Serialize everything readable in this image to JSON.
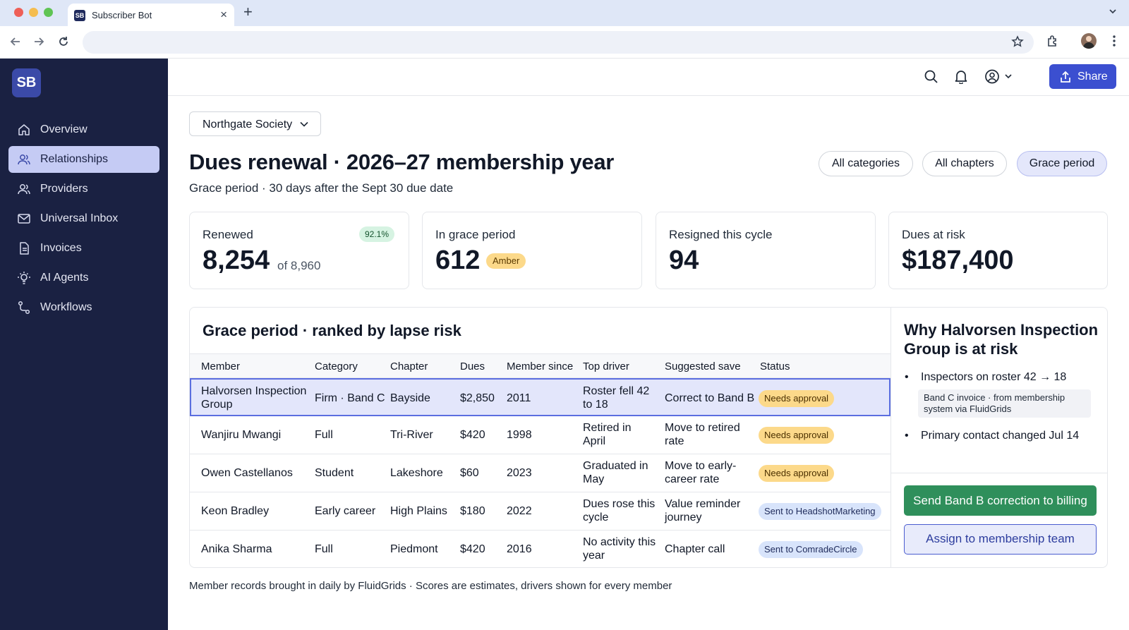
{
  "browser": {
    "tab_icon": "SB",
    "tab_title": "Subscriber Bot"
  },
  "app": {
    "logo": "SB"
  },
  "sidebar": {
    "items": [
      {
        "label": "Overview",
        "icon": "home-icon"
      },
      {
        "label": "Relationships",
        "icon": "users-icon",
        "active": true
      },
      {
        "label": "Providers",
        "icon": "users-icon"
      },
      {
        "label": "Universal Inbox",
        "icon": "mail-icon"
      },
      {
        "label": "Invoices",
        "icon": "document-icon"
      },
      {
        "label": "AI Agents",
        "icon": "bulb-icon"
      },
      {
        "label": "Workflows",
        "icon": "workflow-icon"
      }
    ]
  },
  "header": {
    "share_label": "Share"
  },
  "main": {
    "org": "Northgate Society",
    "title": "Dues renewal · 2026–27 membership year",
    "subtitle": "Grace period · 30 days after the Sept 30 due date",
    "filters": [
      "All categories",
      "All chapters",
      "Grace period"
    ],
    "active_filter": "Grace period"
  },
  "stats": [
    {
      "label": "Renewed",
      "value": "8,254",
      "of": "of 8,960",
      "badge": "92.1%"
    },
    {
      "label": "In grace period",
      "value": "612",
      "badge": "Amber"
    },
    {
      "label": "Resigned this cycle",
      "value": "94"
    },
    {
      "label": "Dues at risk",
      "value": "$187,400"
    }
  ],
  "table": {
    "title": "Grace period · ranked by lapse risk",
    "columns": [
      "Member",
      "Category",
      "Chapter",
      "Dues",
      "Member since",
      "Top driver",
      "Suggested save",
      "Status"
    ],
    "rows": [
      {
        "member_l1": "Halvorsen Inspection",
        "member_l2": "Group",
        "category": "Firm · Band C",
        "chapter": "Bayside",
        "dues": "$2,850",
        "since": "2011",
        "driver_l1": "Roster fell 42",
        "driver_l2": "to 18",
        "save_l1": "Correct to Band B",
        "save_l2": "",
        "status": "Needs approval"
      },
      {
        "member_l1": "Wanjiru Mwangi",
        "member_l2": "",
        "category": "Full",
        "chapter": "Tri-River",
        "dues": "$420",
        "since": "1998",
        "driver_l1": "Retired in",
        "driver_l2": "April",
        "save_l1": "Move to retired",
        "save_l2": "rate",
        "status": "Needs approval"
      },
      {
        "member_l1": "Owen Castellanos",
        "member_l2": "",
        "category": "Student",
        "chapter": "Lakeshore",
        "dues": "$60",
        "since": "2023",
        "driver_l1": "Graduated in",
        "driver_l2": "May",
        "save_l1": "Move to early-",
        "save_l2": "career rate",
        "status": "Needs approval"
      },
      {
        "member_l1": "Keon Bradley",
        "member_l2": "",
        "category": "Early career",
        "chapter": "High Plains",
        "dues": "$180",
        "since": "2022",
        "driver_l1": "Dues rose this",
        "driver_l2": "cycle",
        "save_l1": "Value reminder",
        "save_l2": "journey",
        "status": "Sent to HeadshotMarketing"
      },
      {
        "member_l1": "Anika Sharma",
        "member_l2": "",
        "category": "Full",
        "chapter": "Piedmont",
        "dues": "$420",
        "since": "2016",
        "driver_l1": "No activity this",
        "driver_l2": "year",
        "save_l1": "Chapter call",
        "save_l2": "",
        "status": "Sent to ComradeCircle"
      }
    ]
  },
  "why": {
    "title": "Why Halvorsen Inspection Group is at risk",
    "bullet1": "Inspectors on roster 42 → 18",
    "note": "Band C invoice · from membership system via FluidGrids",
    "bullet2": "Primary contact changed Jul 14",
    "primary_action": "Send Band B correction to billing",
    "secondary_action": "Assign to membership team"
  },
  "footnote": "Member records brought in daily by FluidGrids · Scores are estimates, drivers shown for every member",
  "colors": {
    "sidebar_bg": "#1a2142",
    "accent": "#3b4fd0",
    "success": "#2f8f5b",
    "amber": "#fcd98a"
  }
}
